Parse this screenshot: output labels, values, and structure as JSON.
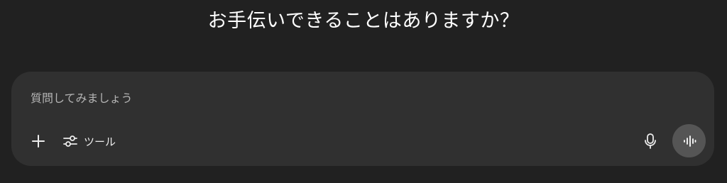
{
  "heading": {
    "text": "お手伝いできることはありますか？"
  },
  "composer": {
    "placeholder": "質問してみましょう",
    "value": "",
    "tools_label": "ツール"
  },
  "icons": {
    "add": "plus-icon",
    "tools": "sliders-icon",
    "mic": "microphone-icon",
    "voice": "voice-mode-icon"
  },
  "colors": {
    "background": "#212121",
    "composer_background": "#303030",
    "voice_button": "#555555",
    "text": "#ffffff",
    "placeholder": "#b4b4b4"
  }
}
